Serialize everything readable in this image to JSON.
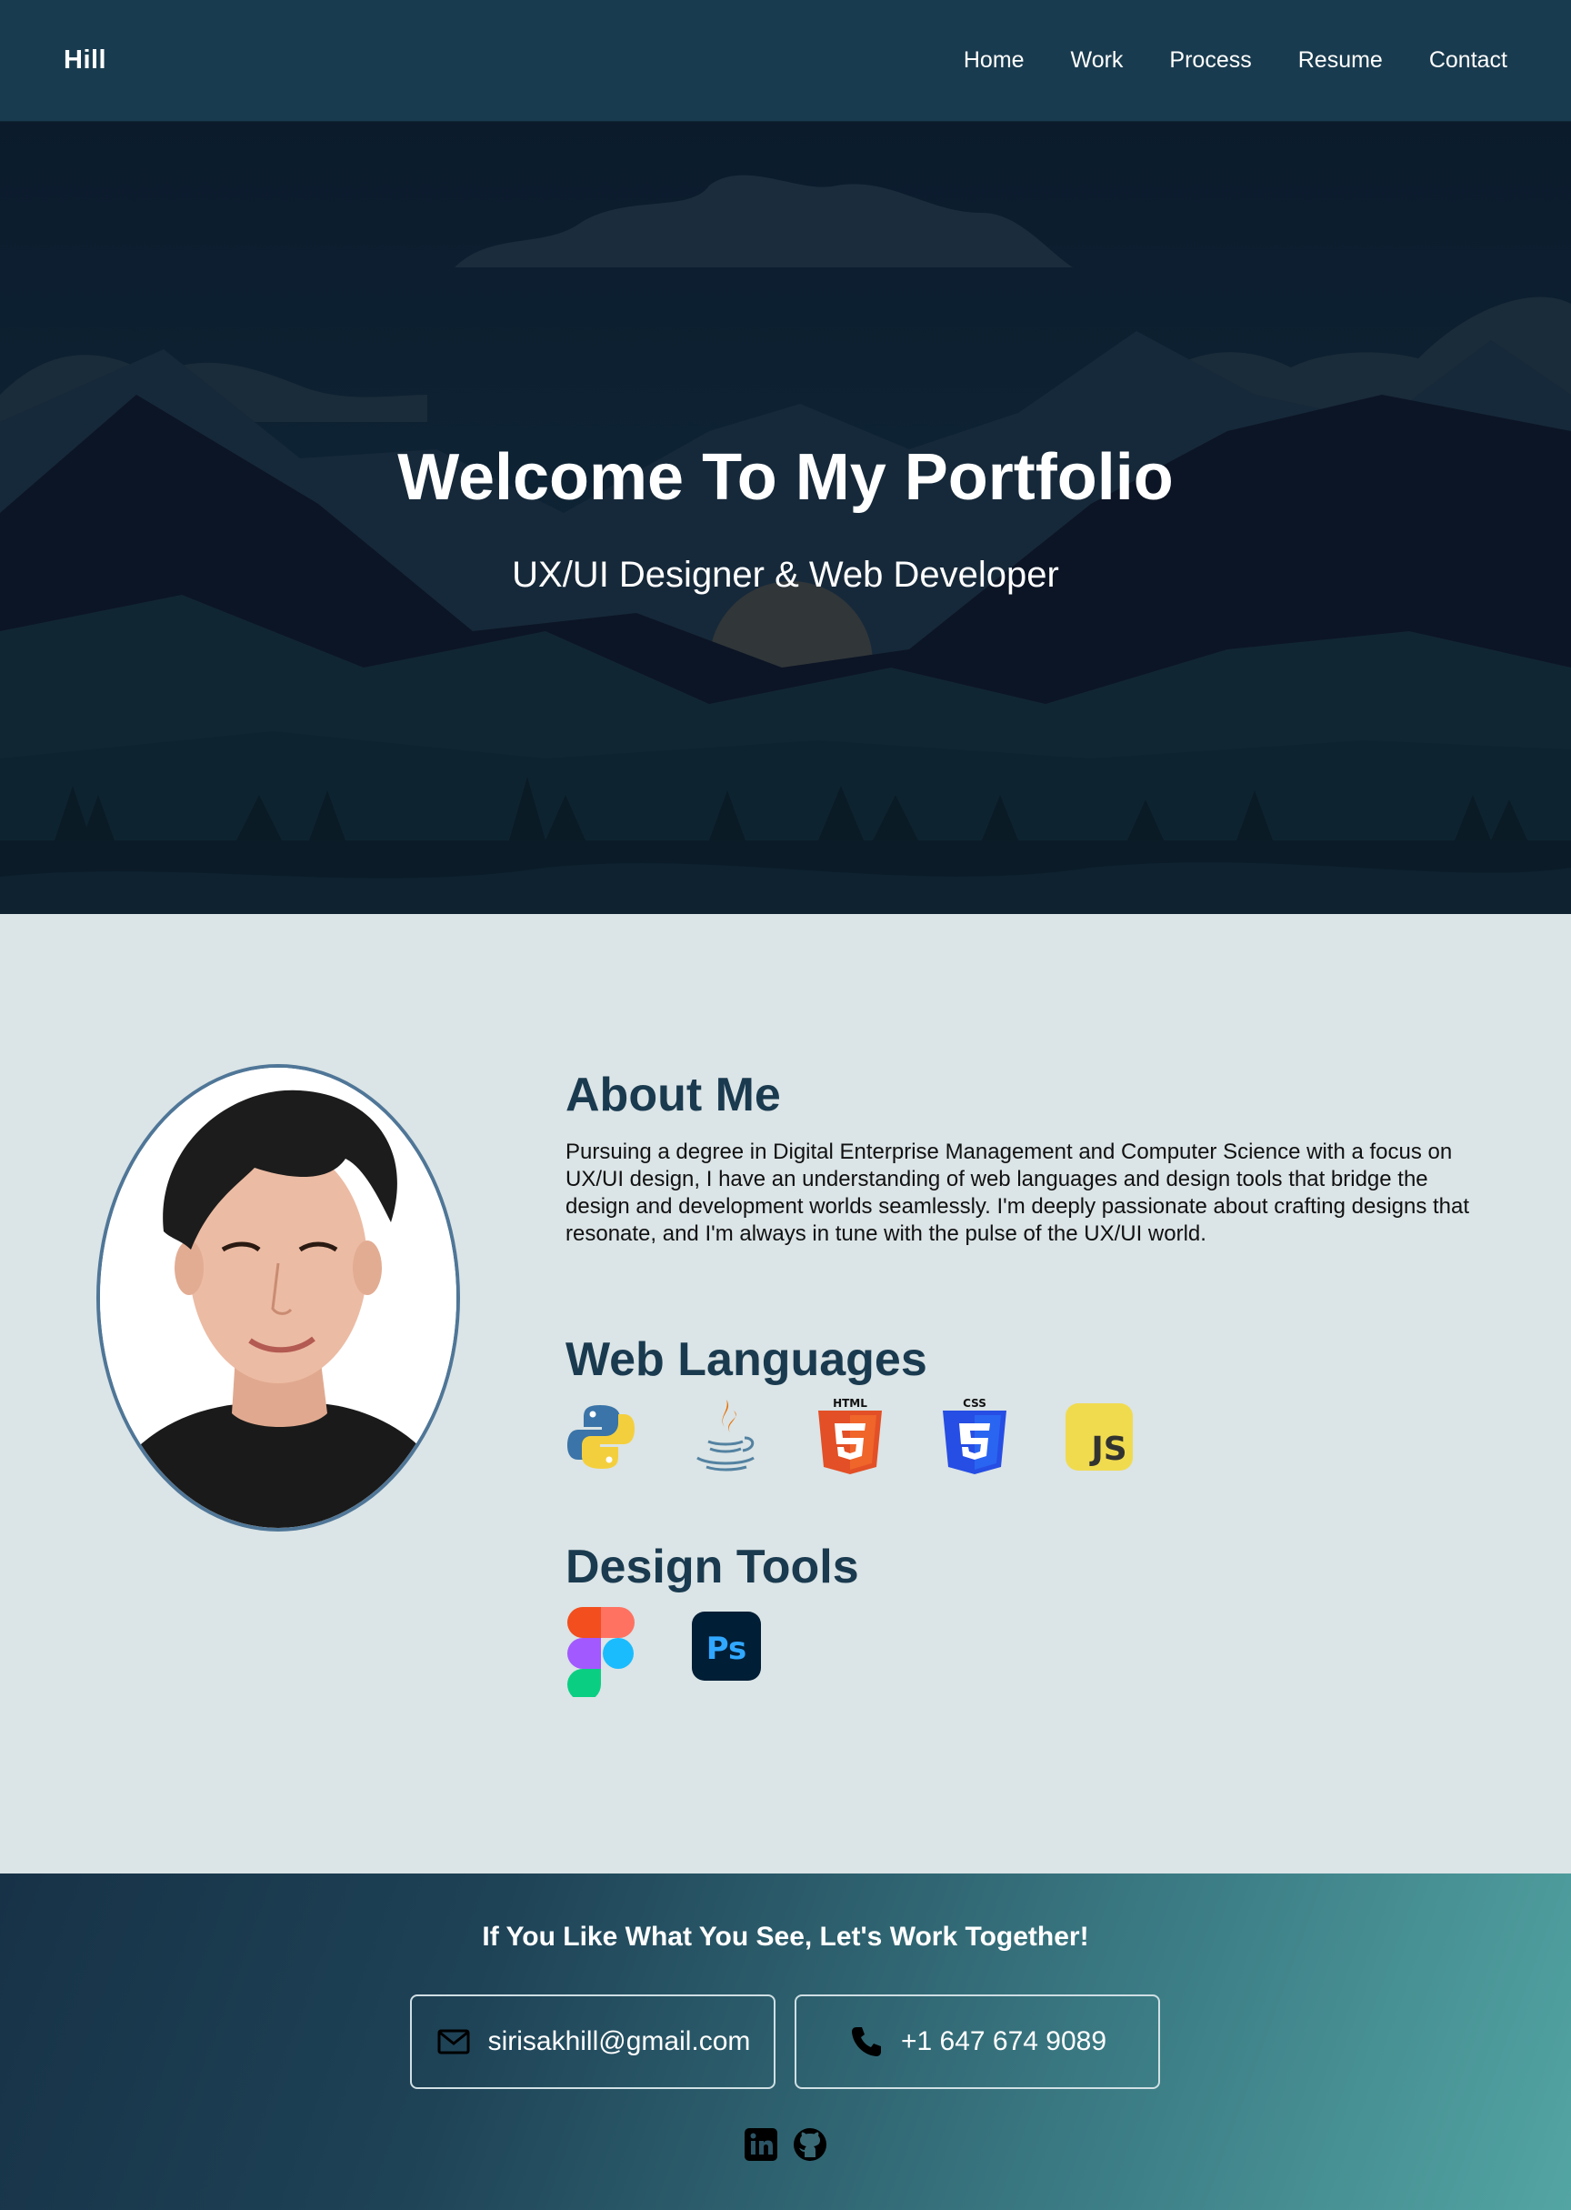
{
  "nav": {
    "brand": "Hill",
    "links": [
      {
        "label": "Home"
      },
      {
        "label": "Work"
      },
      {
        "label": "Process"
      },
      {
        "label": "Resume"
      },
      {
        "label": "Contact"
      }
    ]
  },
  "hero": {
    "title": "Welcome To My Portfolio",
    "subtitle": "UX/UI Designer & Web Developer",
    "background": "mountain-landscape-illustration"
  },
  "about": {
    "portrait": "profile-photo",
    "heading": "About Me",
    "text": "Pursuing a degree in Digital Enterprise Management and Computer Science with a focus on UX/UI design, I have an understanding of web languages and design tools that bridge the design and development worlds seamlessly. I'm deeply passionate about crafting designs that resonate, and I'm always in tune with the pulse of the UX/UI world.",
    "languages_heading": "Web Languages",
    "languages": [
      "python-icon",
      "java-icon",
      "html5-icon",
      "css3-icon",
      "javascript-icon"
    ],
    "html_badge": "HTML",
    "css_badge": "CSS",
    "js_badge": "JS",
    "tools_heading": "Design Tools",
    "tools": [
      "figma-icon",
      "photoshop-icon"
    ],
    "ps_badge": "Ps"
  },
  "footer": {
    "cta": "If You Like What You See, Let's Work Together!",
    "email": "sirisakhill@gmail.com",
    "phone": "+1 647 674 9089",
    "socials": [
      "linkedin-icon",
      "github-icon"
    ]
  },
  "colors": {
    "nav_bg": "#193b4f",
    "heading": "#1a3a4f",
    "section_bg": "#dbe4e6",
    "portrait_border": "#4f7697"
  }
}
